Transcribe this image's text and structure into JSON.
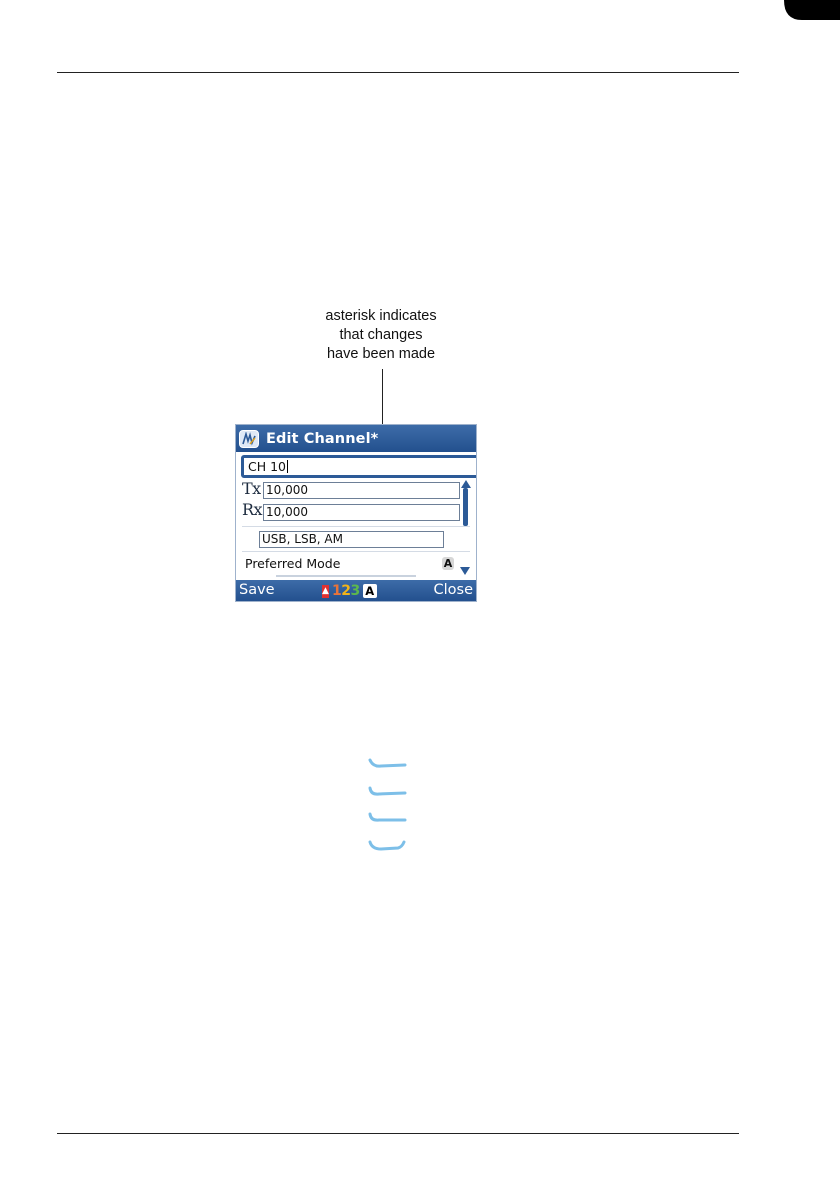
{
  "annotation": {
    "lines": [
      "asterisk indicates",
      "that changes",
      "have been made"
    ]
  },
  "screen": {
    "title": "Edit Channel*",
    "channel_name": "CH 10",
    "tx_label": "Tx",
    "tx_value": "10,000",
    "rx_label": "Rx",
    "rx_value": "10,000",
    "modes": "USB, LSB, AM",
    "preferred_mode_label": "Preferred Mode",
    "preferred_mode_indicator": "A",
    "softkeys": {
      "left": "Save",
      "right": "Close"
    },
    "input_mode": {
      "digits": [
        "1",
        "2",
        "3"
      ],
      "digit_colors": [
        "#e8743a",
        "#f2b318",
        "#5db84c"
      ],
      "alpha": "A"
    }
  },
  "colors": {
    "titlebar": "#23508e",
    "accent": "#2c5a97",
    "hand_marks": "#7dbfe8"
  },
  "icons": [
    "app-icon",
    "caret-icon",
    "scroll-up-icon",
    "scroll-down-icon",
    "input-mode-icon"
  ]
}
